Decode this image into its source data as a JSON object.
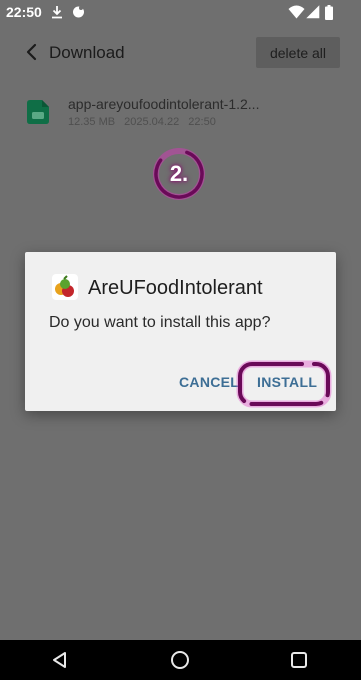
{
  "status_bar": {
    "time": "22:50",
    "icons": [
      "download-icon",
      "notification-icon",
      "wifi-icon",
      "signal-icon",
      "battery-icon"
    ]
  },
  "app_bar": {
    "back_icon": "chevron-left-icon",
    "title": "Download",
    "delete_all_label": "delete all"
  },
  "downloads": [
    {
      "icon": "apk-file-icon",
      "name": "app-areyoufoodintolerant-1.2...",
      "size": "12.35 MB",
      "date": "2025.04.22",
      "time": "22:50"
    }
  ],
  "annotation": {
    "step_label": "2.",
    "highlight_color": "#8a1070"
  },
  "dialog": {
    "app_name": "AreUFoodIntolerant",
    "message": "Do you want to install this app?",
    "cancel_label": "CANCEL",
    "install_label": "INSTALL",
    "button_color": "#3d6e95"
  },
  "nav_bar": {
    "buttons": [
      "back-triangle-icon",
      "home-circle-icon",
      "recents-square-icon"
    ]
  }
}
